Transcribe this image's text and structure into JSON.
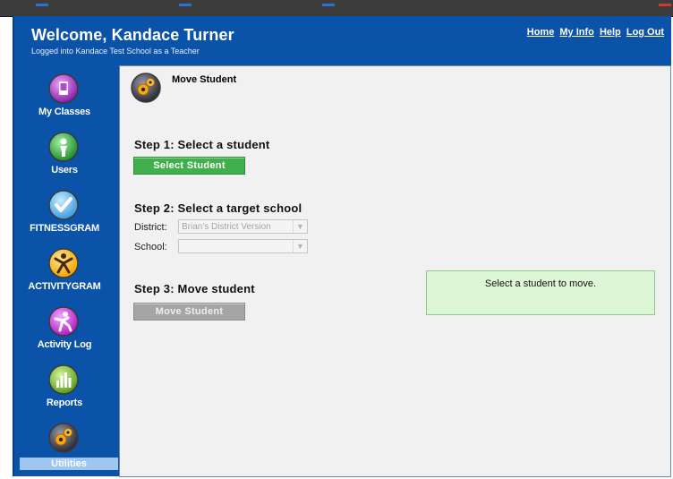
{
  "header": {
    "welcome": "Welcome, Kandace Turner",
    "subline": "Logged into Kandace Test School as a Teacher",
    "links": [
      "Home",
      "My Info",
      "Help",
      "Log Out"
    ]
  },
  "sidebar": {
    "items": [
      {
        "label": "My Classes",
        "icon": "classes-icon"
      },
      {
        "label": "Users",
        "icon": "users-icon"
      },
      {
        "label": "FITNESSGRAM",
        "icon": "fitnessgram-icon"
      },
      {
        "label": "ACTIVITYGRAM",
        "icon": "activitygram-icon"
      },
      {
        "label": "Activity Log",
        "icon": "activity-log-icon"
      },
      {
        "label": "Reports",
        "icon": "reports-icon"
      },
      {
        "label": "Utilities",
        "icon": "utilities-icon",
        "active": true
      }
    ]
  },
  "main": {
    "title": "Move Student",
    "step1": {
      "heading": "Step 1: Select a student",
      "button": "Select Student"
    },
    "step2": {
      "heading": "Step 2: Select a target school",
      "district_label": "District:",
      "district_value": "Brian's District Version",
      "school_label": "School:",
      "school_value": ""
    },
    "step3": {
      "heading": "Step 3: Move student",
      "button": "Move Student"
    },
    "message": "Select a student to move."
  },
  "colors": {
    "frame_blue": "#0a53a8",
    "content_bg": "#f1f1f1",
    "accent_green": "#3fb04c",
    "disabled_gray": "#a5a5a5",
    "message_bg": "#dcf6d6"
  }
}
